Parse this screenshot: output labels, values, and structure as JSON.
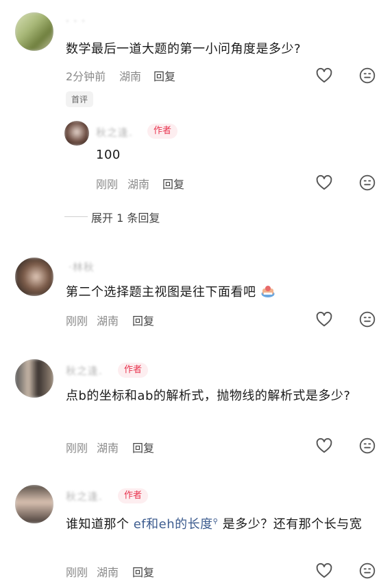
{
  "comments": [
    {
      "username": "· · ·",
      "text": "数学最后一道大题的第一小问角度是多少?",
      "time": "2分钟前",
      "location": "湖南",
      "reply_label": "回复",
      "badge": "首评",
      "replies": [
        {
          "username": "秋之逢.",
          "author_tag": "作者",
          "text": "100",
          "time": "刚刚",
          "location": "湖南",
          "reply_label": "回复"
        }
      ],
      "expand_label": "展开 1 条回复"
    },
    {
      "username": "·林秋",
      "text": "第二个选择题主视图是往下面看吧",
      "time": "刚刚",
      "location": "湖南",
      "reply_label": "回复"
    },
    {
      "username": "秋之逢.",
      "author_tag": "作者",
      "text": "点b的坐标和ab的解析式，抛物线的解析式是多少?",
      "time": "刚刚",
      "location": "湖南",
      "reply_label": "回复"
    },
    {
      "username": "秋之逢.",
      "author_tag": "作者",
      "text_before": "谁知道那个 ",
      "text_link": "ef和eh的长度",
      "text_after": " 是多少？还有那个长与宽",
      "time": "刚刚",
      "location": "湖南",
      "reply_label": "回复"
    }
  ],
  "icons": {
    "like": "heart-outline-icon",
    "dislike": "frown-face-icon",
    "search_hint": "search-hint-icon",
    "emoji": "emoji-icon"
  },
  "colors": {
    "author_tag": "#e8344f",
    "link": "#3d5c8f",
    "meta": "#8a8a8a"
  }
}
